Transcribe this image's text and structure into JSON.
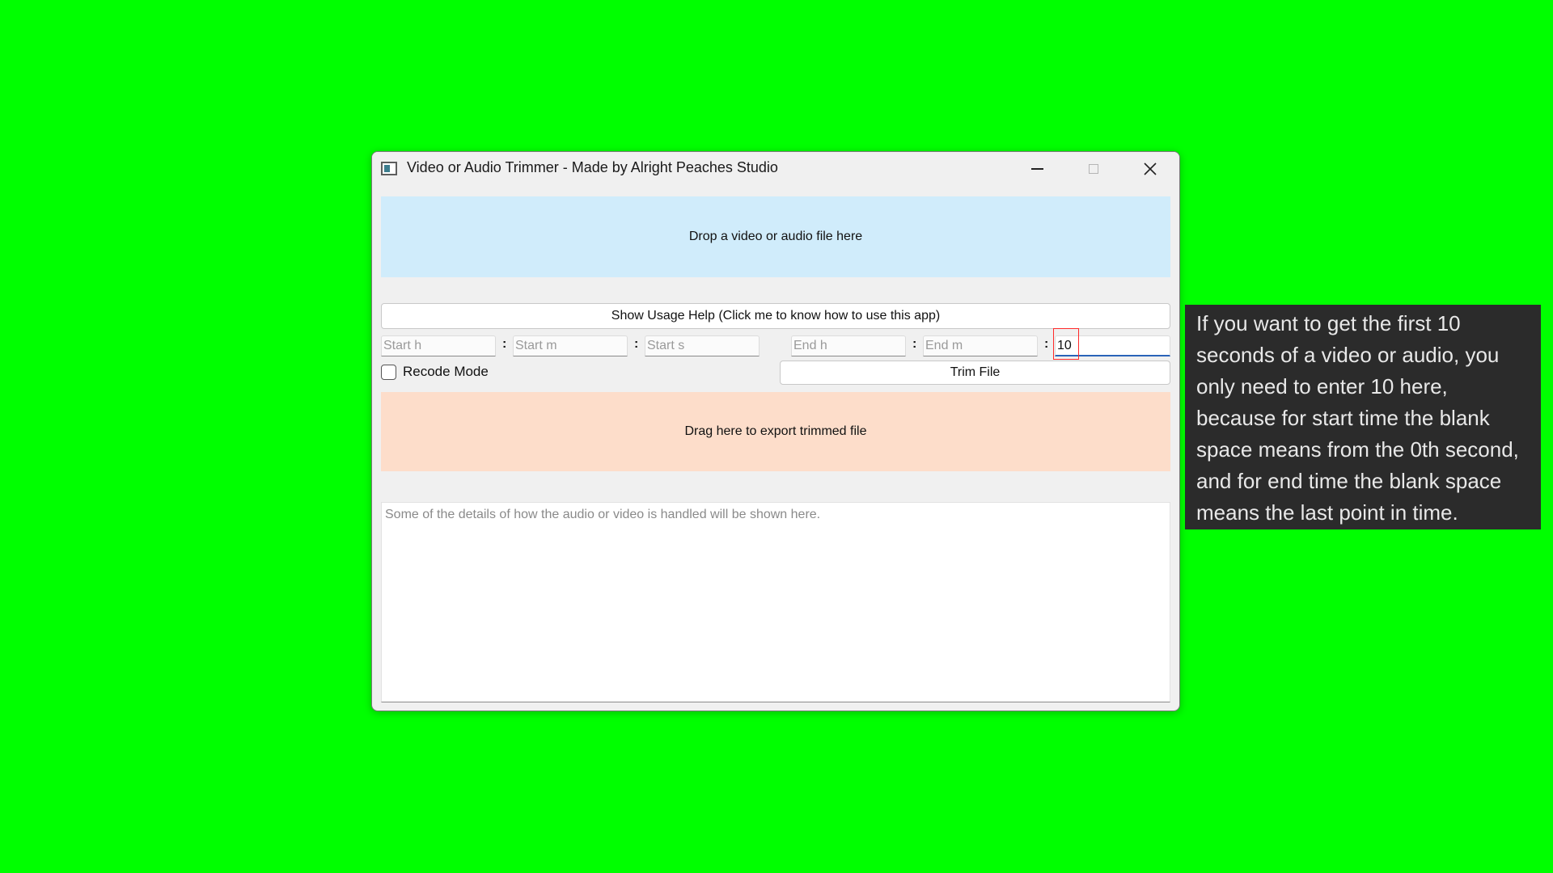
{
  "window": {
    "title": "Video or Audio Trimmer - Made by Alright Peaches Studio",
    "icon": "app-window-icon",
    "controls": {
      "minimize_icon": "minimize-icon",
      "maximize_icon": "maximize-icon",
      "close_icon": "close-icon",
      "close_glyph": "✕"
    }
  },
  "drop_zone": {
    "label": "Drop a video or audio file here",
    "color": "#d0ecfb"
  },
  "help_button": {
    "label": "Show Usage Help (Click me to know how to use this app)"
  },
  "time_inputs": {
    "separator": ":",
    "start_h": {
      "value": "",
      "placeholder": "Start h"
    },
    "start_m": {
      "value": "",
      "placeholder": "Start m"
    },
    "start_s": {
      "value": "",
      "placeholder": "Start s"
    },
    "end_h": {
      "value": "",
      "placeholder": "End h"
    },
    "end_m": {
      "value": "",
      "placeholder": "End m"
    },
    "end_s": {
      "value": "10",
      "placeholder": ""
    }
  },
  "recode_mode": {
    "label": "Recode Mode",
    "checked": false
  },
  "trim_button": {
    "label": "Trim File"
  },
  "export_zone": {
    "label": "Drag here to export trimmed file",
    "color": "#fdddca"
  },
  "log_area": {
    "placeholder": "Some of the details of how the audio or video is handled will be shown here."
  },
  "tooltip": {
    "text": "If you want to get the first 10 seconds of a video or audio, you only need to enter 10 here, because for start time the blank space means from the 0th second, and for end time the blank space means the last point in time."
  },
  "colors": {
    "background": "#00ff00",
    "highlight": "#ff2a2a",
    "focus_underline": "#2a63b8"
  }
}
